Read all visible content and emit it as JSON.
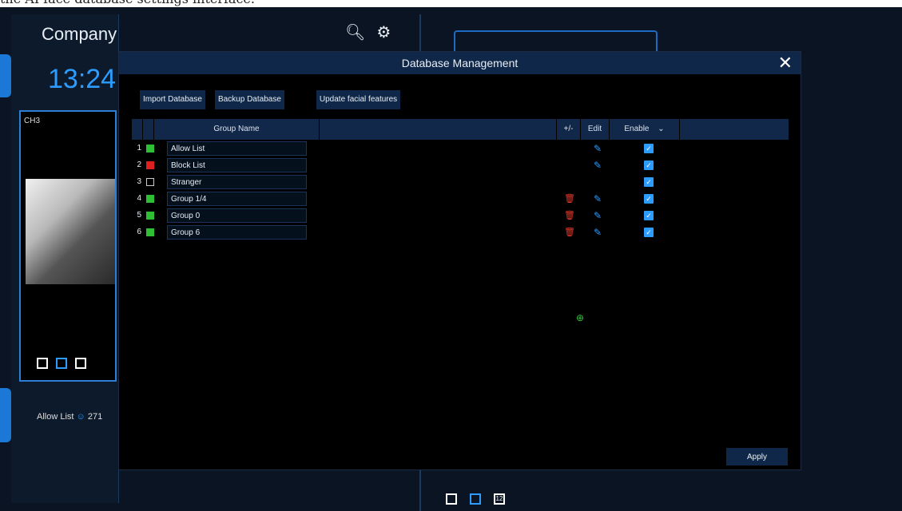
{
  "caption": "the AI face database settings interface.",
  "background": {
    "company": "Company",
    "clock": "13:24",
    "channel_label": "CH3",
    "allow_list_label": "Allow List",
    "allow_list_count": "271",
    "bottom_bar_last": "12"
  },
  "modal": {
    "title": "Database Management",
    "toolbar": {
      "import": "Import Database",
      "backup": "Backup Database",
      "update": "Update facial features"
    },
    "headers": {
      "group_name": "Group Name",
      "plus_minus": "+/-",
      "edit": "Edit",
      "enable": "Enable"
    },
    "rows": [
      {
        "num": "1",
        "color": "#2fbf35",
        "name": "Allow List",
        "deletable": false,
        "editable": true,
        "enabled": true
      },
      {
        "num": "2",
        "color": "#e02020",
        "name": "Block List",
        "deletable": false,
        "editable": true,
        "enabled": true
      },
      {
        "num": "3",
        "color": "#000000",
        "name": "Stranger",
        "deletable": false,
        "editable": false,
        "enabled": true
      },
      {
        "num": "4",
        "color": "#2fbf35",
        "name": "Group 1/4",
        "deletable": true,
        "editable": true,
        "enabled": true
      },
      {
        "num": "5",
        "color": "#2fbf35",
        "name": "Group 0",
        "deletable": true,
        "editable": true,
        "enabled": true
      },
      {
        "num": "6",
        "color": "#2fbf35",
        "name": "Group 6",
        "deletable": true,
        "editable": true,
        "enabled": true
      }
    ],
    "apply": "Apply"
  },
  "colors": {
    "accent": "#2d9cff",
    "delete": "#e53a2e",
    "add": "#36c43a"
  }
}
